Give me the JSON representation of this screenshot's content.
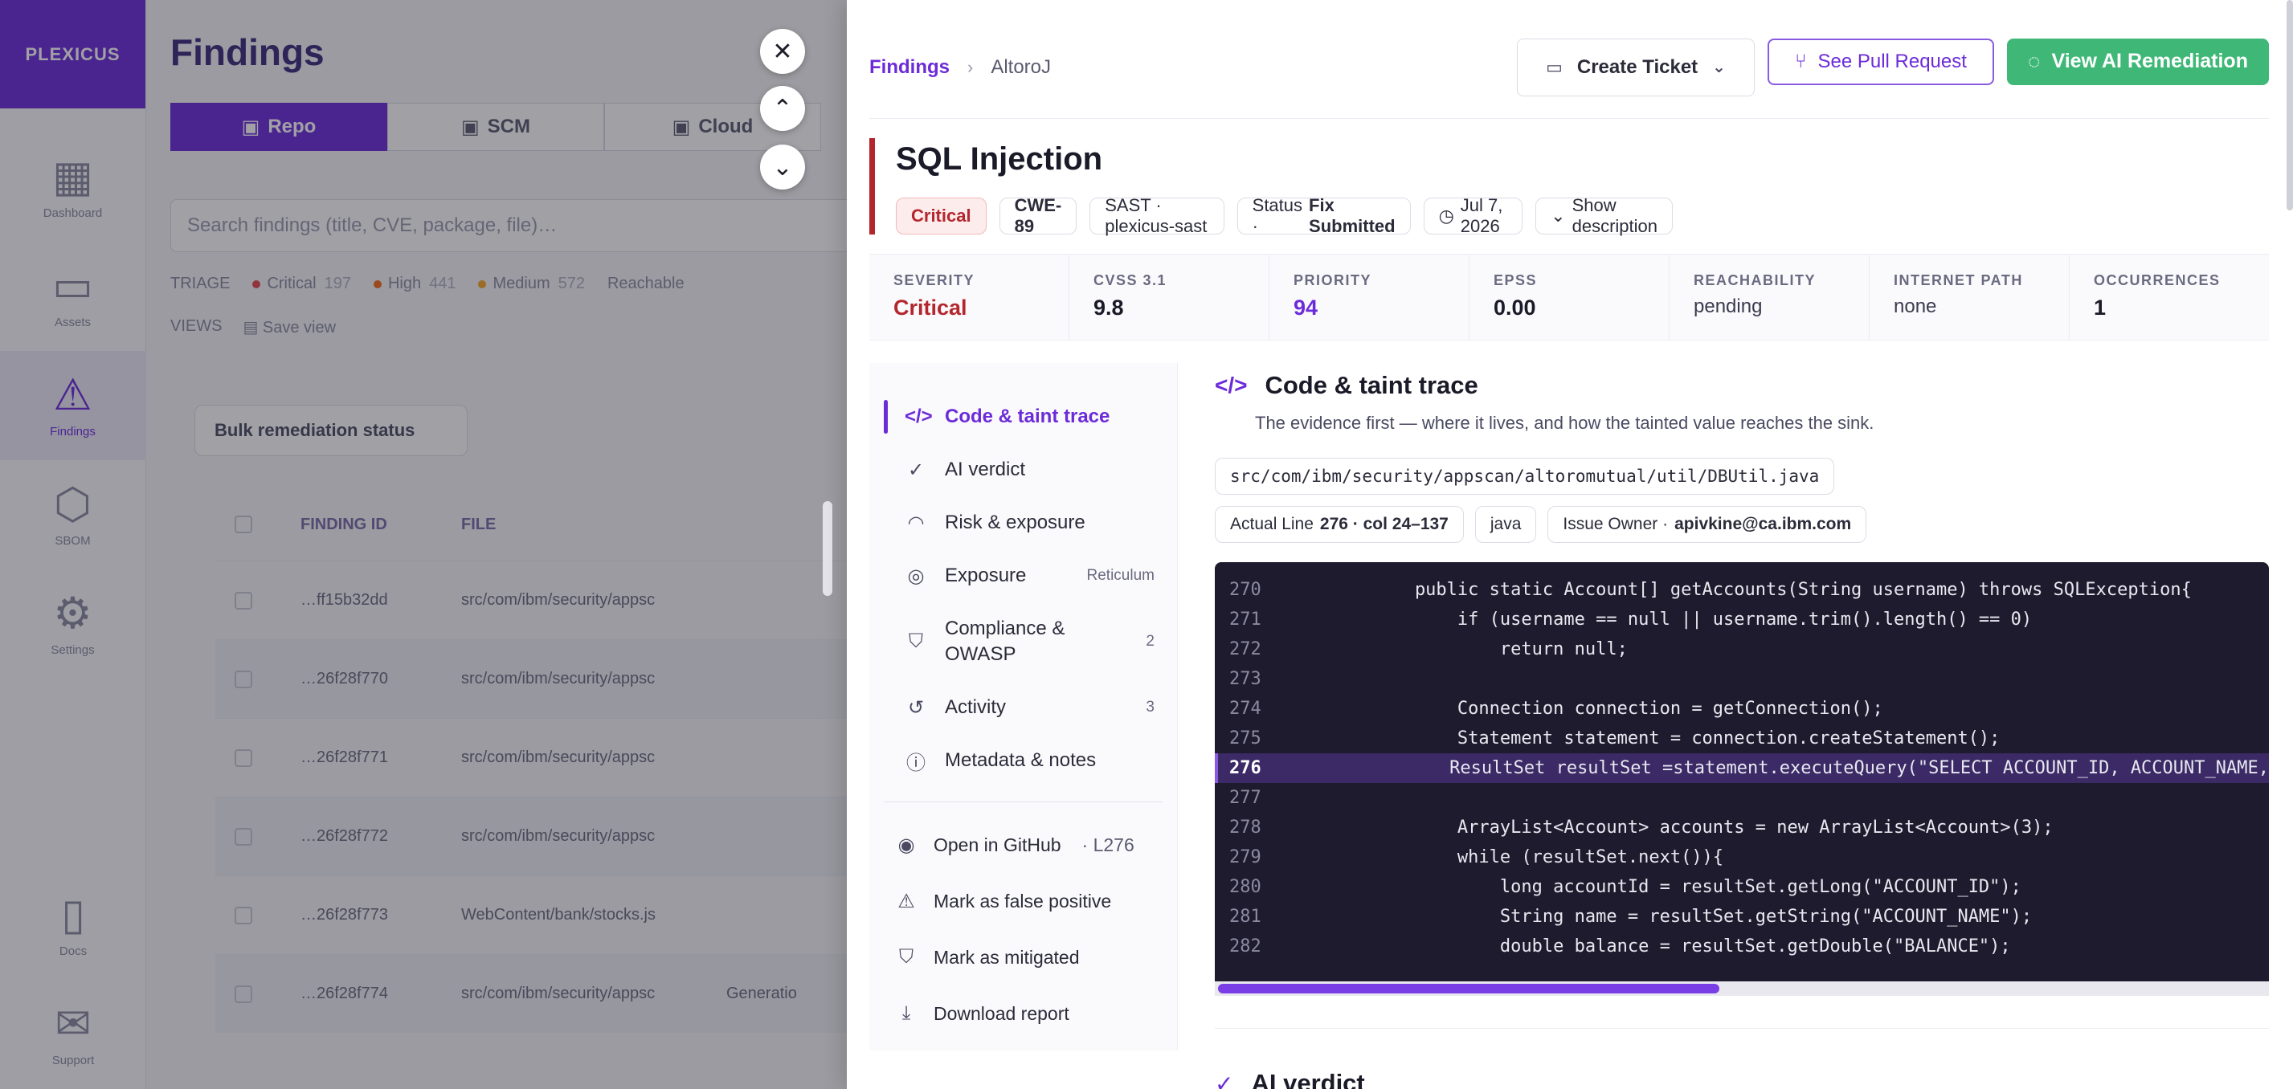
{
  "background": {
    "logo": "PLEXICUS",
    "page_title": "Findings",
    "nav": [
      {
        "label": "Dashboard",
        "icon": "dashboard-icon",
        "glyph": "▦"
      },
      {
        "label": "Assets",
        "icon": "folder-icon",
        "glyph": "▭"
      },
      {
        "label": "Findings",
        "icon": "warning-icon",
        "glyph": "⚠"
      },
      {
        "label": "SBOM",
        "icon": "cube-icon",
        "glyph": "⬡"
      },
      {
        "label": "Settings",
        "icon": "gear-icon",
        "glyph": "⚙"
      }
    ],
    "nav_bottom": [
      {
        "label": "Docs",
        "icon": "book-icon",
        "glyph": "▯"
      },
      {
        "label": "Support",
        "icon": "mail-icon",
        "glyph": "✉"
      }
    ],
    "tabs": [
      "Repo",
      "SCM",
      "Cloud"
    ],
    "search_placeholder": "Search findings (title, CVE, package, file)…",
    "triage_label": "TRIAGE",
    "triage": [
      {
        "label": "Critical",
        "count": "197",
        "color": "#e5484d"
      },
      {
        "label": "High",
        "count": "441",
        "color": "#f76b15"
      },
      {
        "label": "Medium",
        "count": "572",
        "color": "#f5a623"
      },
      {
        "label": "Reachable",
        "count": "",
        "color": ""
      }
    ],
    "views_label": "VIEWS",
    "save_view": "Save view",
    "bulk_status": "Bulk remediation status",
    "columns": [
      "FINDING ID",
      "FILE"
    ],
    "rows": [
      {
        "id": "…ff15b32dd",
        "file": "src/com/ibm/security/appsc",
        "extra": ""
      },
      {
        "id": "…26f28f770",
        "file": "src/com/ibm/security/appsc",
        "extra": ""
      },
      {
        "id": "…26f28f771",
        "file": "src/com/ibm/security/appsc",
        "extra": ""
      },
      {
        "id": "…26f28f772",
        "file": "src/com/ibm/security/appsc",
        "extra": ""
      },
      {
        "id": "…26f28f773",
        "file": "WebContent/bank/stocks.js",
        "extra": ""
      },
      {
        "id": "…26f28f774",
        "file": "src/com/ibm/security/appsc",
        "extra": "Generatio"
      }
    ]
  },
  "drawer": {
    "breadcrumb": {
      "root": "Findings",
      "current": "AltoroJ"
    },
    "actions": {
      "create_ticket": "Create Ticket",
      "see_pr": "See Pull Request",
      "view_ai": "View AI Remediation"
    },
    "title": "SQL Injection",
    "chips": {
      "severity": "Critical",
      "cwe": "CWE-89",
      "scanner": "SAST · plexicus-sast",
      "status_label": "Status ·",
      "status_value": "Fix Submitted",
      "date": "Jul 7, 2026",
      "show_description": "Show description"
    },
    "metrics": [
      {
        "label": "SEVERITY",
        "value": "Critical",
        "color": "#b3262d",
        "style": "bold"
      },
      {
        "label": "CVSS 3.1",
        "value": "9.8",
        "color": "#1a1a28",
        "style": "bold"
      },
      {
        "label": "PRIORITY",
        "value": "94",
        "color": "#6c2bd9",
        "style": "bold"
      },
      {
        "label": "EPSS",
        "value": "0.00",
        "color": "#1a1a28",
        "style": "bold"
      },
      {
        "label": "REACHABILITY",
        "value": "pending",
        "color": "#3a3a4e",
        "style": "light"
      },
      {
        "label": "INTERNET PATH",
        "value": "none",
        "color": "#3a3a4e",
        "style": "light"
      },
      {
        "label": "OCCURRENCES",
        "value": "1",
        "color": "#1a1a28",
        "style": "bold"
      }
    ],
    "nav": [
      {
        "label": "Code & taint trace",
        "icon": "code-icon",
        "glyph": "</>",
        "badge": "",
        "active": true
      },
      {
        "label": "AI verdict",
        "icon": "check-circle-icon",
        "glyph": "✓",
        "badge": "",
        "active": false
      },
      {
        "label": "Risk & exposure",
        "icon": "gauge-icon",
        "glyph": "◠",
        "badge": "",
        "active": false
      },
      {
        "label": "Exposure",
        "icon": "radar-icon",
        "glyph": "◎",
        "badge": "Reticulum",
        "active": false
      },
      {
        "label": "Compliance & OWASP",
        "icon": "shield-check-icon",
        "glyph": "⛉",
        "badge": "2",
        "active": false
      },
      {
        "label": "Activity",
        "icon": "history-icon",
        "glyph": "↺",
        "badge": "3",
        "active": false
      },
      {
        "label": "Metadata & notes",
        "icon": "info-icon",
        "glyph": "ⓘ",
        "badge": "",
        "active": false
      }
    ],
    "side_actions": [
      {
        "label": "Open in GitHub",
        "sub": "· L276",
        "icon": "github-icon",
        "glyph": "◉"
      },
      {
        "label": "Mark as false positive",
        "sub": "",
        "icon": "warning-icon",
        "glyph": "⚠"
      },
      {
        "label": "Mark as mitigated",
        "sub": "",
        "icon": "shield-icon",
        "glyph": "⛉"
      },
      {
        "label": "Download report",
        "sub": "",
        "icon": "download-icon",
        "glyph": "⤓"
      }
    ],
    "section": {
      "title": "Code & taint trace",
      "desc": "The evidence first — where it lives, and how the tainted value reaches the sink.",
      "file_path": "src/com/ibm/security/appscan/altoromutual/util/DBUtil.java",
      "actual_line_label": "Actual Line",
      "actual_line_value": "276 · col 24–137",
      "language": "java",
      "issue_owner_label": "Issue Owner ·",
      "issue_owner_value": "apivkine@ca.ibm.com"
    },
    "code": [
      {
        "n": "270",
        "text": "            public static Account[] getAccounts(String username) throws SQLException{",
        "hl": false
      },
      {
        "n": "271",
        "text": "                if (username == null || username.trim().length() == 0)",
        "hl": false
      },
      {
        "n": "272",
        "text": "                    return null;",
        "hl": false
      },
      {
        "n": "273",
        "text": "",
        "hl": false
      },
      {
        "n": "274",
        "text": "                Connection connection = getConnection();",
        "hl": false
      },
      {
        "n": "275",
        "text": "                Statement statement = connection.createStatement();",
        "hl": false
      },
      {
        "n": "276",
        "text": "                ResultSet resultSet =statement.executeQuery(\"SELECT ACCOUNT_ID, ACCOUNT_NAME,",
        "hl": true
      },
      {
        "n": "277",
        "text": "",
        "hl": false
      },
      {
        "n": "278",
        "text": "                ArrayList<Account> accounts = new ArrayList<Account>(3);",
        "hl": false
      },
      {
        "n": "279",
        "text": "                while (resultSet.next()){",
        "hl": false
      },
      {
        "n": "280",
        "text": "                    long accountId = resultSet.getLong(\"ACCOUNT_ID\");",
        "hl": false
      },
      {
        "n": "281",
        "text": "                    String name = resultSet.getString(\"ACCOUNT_NAME\");",
        "hl": false
      },
      {
        "n": "282",
        "text": "                    double balance = resultSet.getDouble(\"BALANCE\");",
        "hl": false
      }
    ],
    "next_section_title": "AI verdict"
  }
}
